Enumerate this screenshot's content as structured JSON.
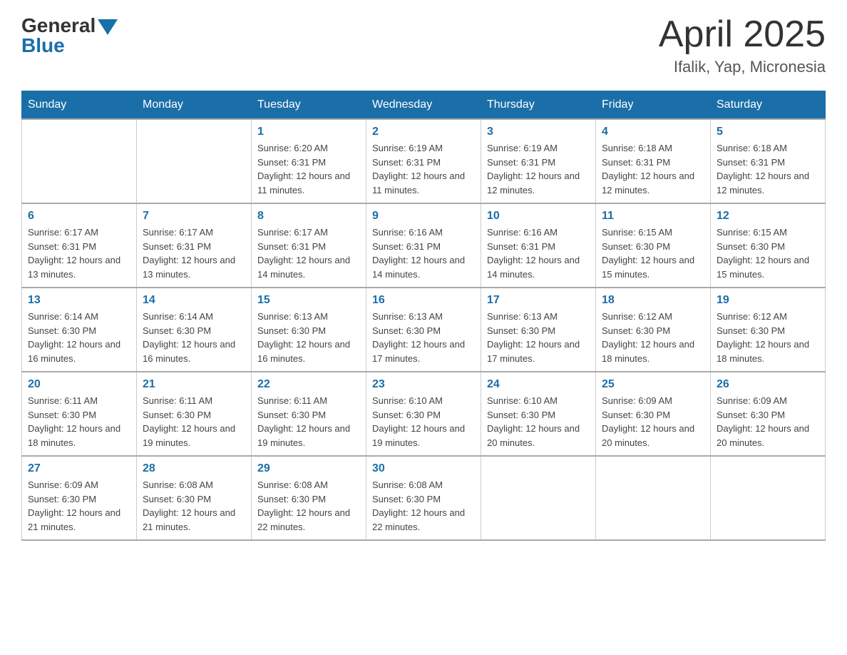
{
  "header": {
    "logo_general": "General",
    "logo_blue": "Blue",
    "main_title": "April 2025",
    "subtitle": "Ifalik, Yap, Micronesia"
  },
  "days_of_week": [
    "Sunday",
    "Monday",
    "Tuesday",
    "Wednesday",
    "Thursday",
    "Friday",
    "Saturday"
  ],
  "weeks": [
    [
      {
        "day": "",
        "info": ""
      },
      {
        "day": "",
        "info": ""
      },
      {
        "day": "1",
        "info": "Sunrise: 6:20 AM\nSunset: 6:31 PM\nDaylight: 12 hours and 11 minutes."
      },
      {
        "day": "2",
        "info": "Sunrise: 6:19 AM\nSunset: 6:31 PM\nDaylight: 12 hours and 11 minutes."
      },
      {
        "day": "3",
        "info": "Sunrise: 6:19 AM\nSunset: 6:31 PM\nDaylight: 12 hours and 12 minutes."
      },
      {
        "day": "4",
        "info": "Sunrise: 6:18 AM\nSunset: 6:31 PM\nDaylight: 12 hours and 12 minutes."
      },
      {
        "day": "5",
        "info": "Sunrise: 6:18 AM\nSunset: 6:31 PM\nDaylight: 12 hours and 12 minutes."
      }
    ],
    [
      {
        "day": "6",
        "info": "Sunrise: 6:17 AM\nSunset: 6:31 PM\nDaylight: 12 hours and 13 minutes."
      },
      {
        "day": "7",
        "info": "Sunrise: 6:17 AM\nSunset: 6:31 PM\nDaylight: 12 hours and 13 minutes."
      },
      {
        "day": "8",
        "info": "Sunrise: 6:17 AM\nSunset: 6:31 PM\nDaylight: 12 hours and 14 minutes."
      },
      {
        "day": "9",
        "info": "Sunrise: 6:16 AM\nSunset: 6:31 PM\nDaylight: 12 hours and 14 minutes."
      },
      {
        "day": "10",
        "info": "Sunrise: 6:16 AM\nSunset: 6:31 PM\nDaylight: 12 hours and 14 minutes."
      },
      {
        "day": "11",
        "info": "Sunrise: 6:15 AM\nSunset: 6:30 PM\nDaylight: 12 hours and 15 minutes."
      },
      {
        "day": "12",
        "info": "Sunrise: 6:15 AM\nSunset: 6:30 PM\nDaylight: 12 hours and 15 minutes."
      }
    ],
    [
      {
        "day": "13",
        "info": "Sunrise: 6:14 AM\nSunset: 6:30 PM\nDaylight: 12 hours and 16 minutes."
      },
      {
        "day": "14",
        "info": "Sunrise: 6:14 AM\nSunset: 6:30 PM\nDaylight: 12 hours and 16 minutes."
      },
      {
        "day": "15",
        "info": "Sunrise: 6:13 AM\nSunset: 6:30 PM\nDaylight: 12 hours and 16 minutes."
      },
      {
        "day": "16",
        "info": "Sunrise: 6:13 AM\nSunset: 6:30 PM\nDaylight: 12 hours and 17 minutes."
      },
      {
        "day": "17",
        "info": "Sunrise: 6:13 AM\nSunset: 6:30 PM\nDaylight: 12 hours and 17 minutes."
      },
      {
        "day": "18",
        "info": "Sunrise: 6:12 AM\nSunset: 6:30 PM\nDaylight: 12 hours and 18 minutes."
      },
      {
        "day": "19",
        "info": "Sunrise: 6:12 AM\nSunset: 6:30 PM\nDaylight: 12 hours and 18 minutes."
      }
    ],
    [
      {
        "day": "20",
        "info": "Sunrise: 6:11 AM\nSunset: 6:30 PM\nDaylight: 12 hours and 18 minutes."
      },
      {
        "day": "21",
        "info": "Sunrise: 6:11 AM\nSunset: 6:30 PM\nDaylight: 12 hours and 19 minutes."
      },
      {
        "day": "22",
        "info": "Sunrise: 6:11 AM\nSunset: 6:30 PM\nDaylight: 12 hours and 19 minutes."
      },
      {
        "day": "23",
        "info": "Sunrise: 6:10 AM\nSunset: 6:30 PM\nDaylight: 12 hours and 19 minutes."
      },
      {
        "day": "24",
        "info": "Sunrise: 6:10 AM\nSunset: 6:30 PM\nDaylight: 12 hours and 20 minutes."
      },
      {
        "day": "25",
        "info": "Sunrise: 6:09 AM\nSunset: 6:30 PM\nDaylight: 12 hours and 20 minutes."
      },
      {
        "day": "26",
        "info": "Sunrise: 6:09 AM\nSunset: 6:30 PM\nDaylight: 12 hours and 20 minutes."
      }
    ],
    [
      {
        "day": "27",
        "info": "Sunrise: 6:09 AM\nSunset: 6:30 PM\nDaylight: 12 hours and 21 minutes."
      },
      {
        "day": "28",
        "info": "Sunrise: 6:08 AM\nSunset: 6:30 PM\nDaylight: 12 hours and 21 minutes."
      },
      {
        "day": "29",
        "info": "Sunrise: 6:08 AM\nSunset: 6:30 PM\nDaylight: 12 hours and 22 minutes."
      },
      {
        "day": "30",
        "info": "Sunrise: 6:08 AM\nSunset: 6:30 PM\nDaylight: 12 hours and 22 minutes."
      },
      {
        "day": "",
        "info": ""
      },
      {
        "day": "",
        "info": ""
      },
      {
        "day": "",
        "info": ""
      }
    ]
  ]
}
